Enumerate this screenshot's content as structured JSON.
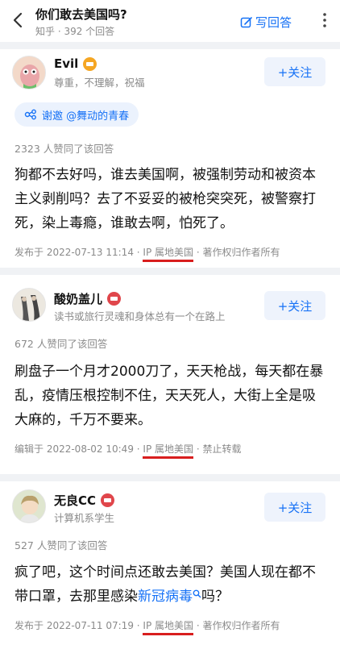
{
  "header": {
    "title": "你们敢去美国吗?",
    "meta": "知乎 · 392 个回答",
    "write_label": "写回答"
  },
  "answers": [
    {
      "user": "Evil",
      "bio": "尊重，不理解，祝福",
      "follow": "+关注",
      "invite": "谢邀 @舞动的青春",
      "votes": "2323 人赞同了该回答",
      "content": "狗都不去好吗，谁去美国啊，被强制劳动和被资本主义剥削吗？去了不妥妥的被枪突突死，被警察打死，染上毒瘾，谁敢去啊，怕死了。",
      "foot_prefix": "发布于 2022-07-13 11:14 · ",
      "ip": "IP 属地美国",
      "foot_suffix": " · 著作权归作者所有"
    },
    {
      "user": "酸奶盖儿",
      "bio": "读书或旅行灵魂和身体总有一个在路上",
      "follow": "+关注",
      "votes": "672 人赞同了该回答",
      "content": "刷盘子一个月才2000刀了，天天枪战，每天都在暴乱，疫情压根控制不住，天天死人，大街上全是吸大麻的，千万不要来。",
      "foot_prefix": "编辑于 2022-08-02 10:49 · ",
      "ip": "IP 属地美国",
      "foot_suffix": " · 禁止转载"
    },
    {
      "user": "无良CC",
      "bio": "计算机系学生",
      "follow": "+关注",
      "votes": "527 人赞同了该回答",
      "content_a": "疯了吧，这个时间点还敢去美国？美国人现在都不带口罩，去那里感染",
      "content_link": "新冠病毒",
      "content_b": "吗？",
      "foot_prefix": "发布于 2022-07-11 07:19 · ",
      "ip": "IP 属地美国",
      "foot_suffix": " · 著作权归作者所有"
    }
  ],
  "colors": {
    "accent": "#1772f6",
    "underline": "#d81e1e",
    "badge_gold": "#f5a623",
    "badge_red": "#e0464b"
  }
}
